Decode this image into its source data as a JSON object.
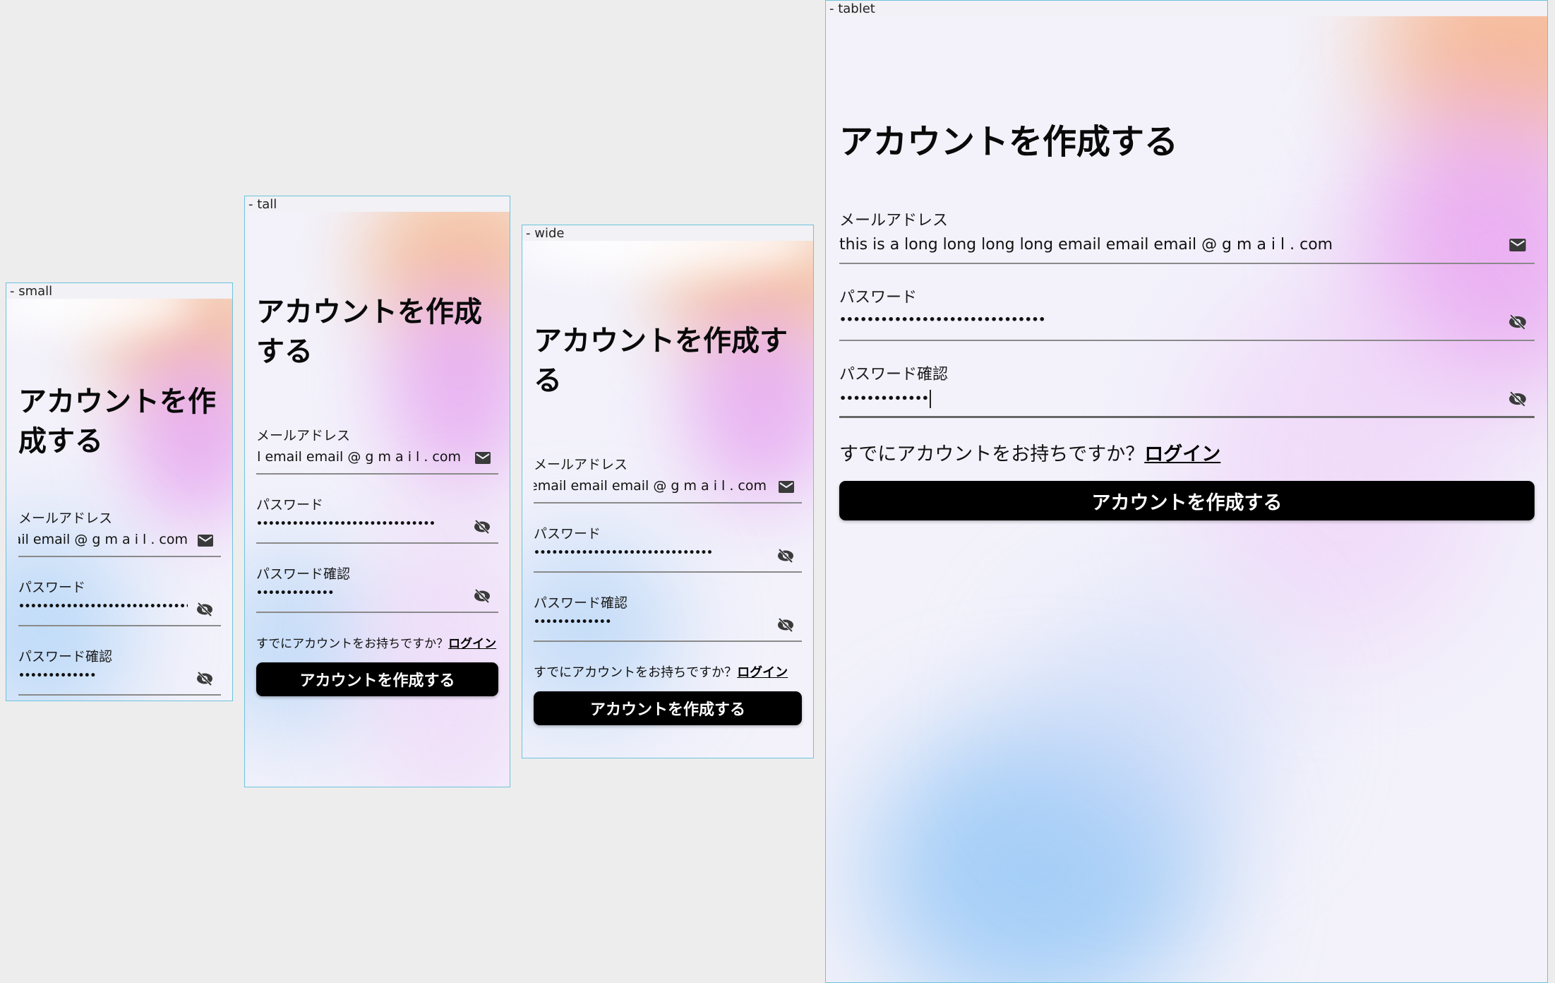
{
  "frames": {
    "small": {
      "label": "- small",
      "heading": "アカウントを作成する",
      "email_label": "メールアドレス",
      "email_value": "this is a long long long long email email email @ g m a i l . com",
      "password_label": "パスワード",
      "password_value": "••••••••••••••••••••••••••••••",
      "confirm_label": "パスワード確認",
      "confirm_value": "•••••••••••••"
    },
    "tall": {
      "label": "- tall",
      "heading": "アカウントを作成する",
      "email_label": "メールアドレス",
      "email_value": "this is a long long long long email email email @ g m a i l . com",
      "password_label": "パスワード",
      "password_value": "••••••••••••••••••••••••••••••",
      "confirm_label": "パスワード確認",
      "confirm_value": "•••••••••••••",
      "login_prompt": "すでにアカウントをお持ちですか？",
      "login_link": "ログイン",
      "submit_label": "アカウントを作成する"
    },
    "wide": {
      "label": "- wide",
      "heading": "アカウントを作成する",
      "email_label": "メールアドレス",
      "email_value": "this is a long long long long email email email @ g m a i l . com",
      "password_label": "パスワード",
      "password_value": "••••••••••••••••••••••••••••••",
      "confirm_label": "パスワード確認",
      "confirm_value": "•••••••••••••",
      "login_prompt": "すでにアカウントをお持ちですか？",
      "login_link": "ログイン",
      "submit_label": "アカウントを作成する"
    },
    "tablet": {
      "label": "- tablet",
      "heading": "アカウントを作成する",
      "email_label": "メールアドレス",
      "email_value": "this is a long long long long email email email @ g m a i l . com",
      "password_label": "パスワード",
      "password_value": "••••••••••••••••••••••••••••••",
      "confirm_label": "パスワード確認",
      "confirm_value": "•••••••••••••",
      "login_prompt": "すでにアカウントをお持ちですか？",
      "login_link": "ログイン",
      "submit_label": "アカウントを作成する"
    }
  },
  "icons": {
    "email": "mail-icon",
    "password_toggle": "eye-off-icon"
  },
  "colors": {
    "button_bg": "#000000",
    "button_text": "#ffffff",
    "frame_border": "#6cc3dd",
    "gradient_orange": "#f7b98a",
    "gradient_pink": "#e7a9f0",
    "gradient_blue": "#9ccdf7"
  }
}
